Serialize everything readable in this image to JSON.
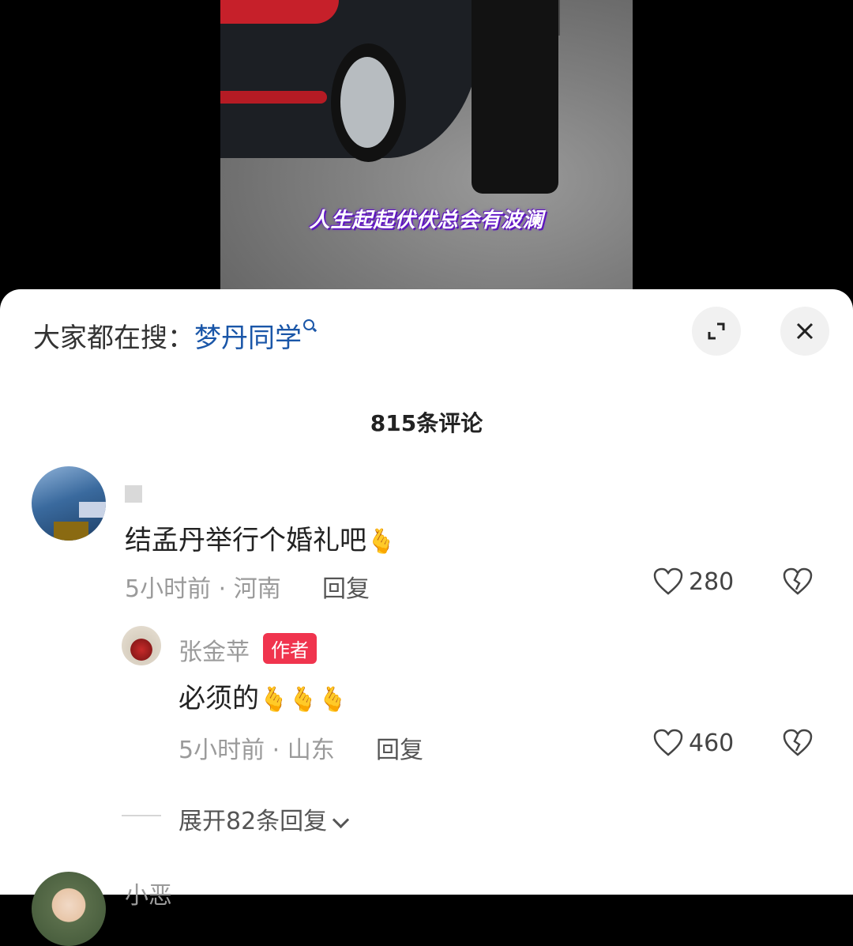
{
  "video": {
    "subtitle": "人生起起伏伏总会有波澜"
  },
  "sheet": {
    "search_prefix": "大家都在搜：",
    "search_keyword": "梦丹同学",
    "comment_count": "815条评论"
  },
  "comments": [
    {
      "text": "结孟丹举行个婚礼吧",
      "emoji": "🫰",
      "time": "5小时前 · 河南",
      "reply_label": "回复",
      "likes": "280"
    }
  ],
  "reply": {
    "author": "张金苹",
    "badge": "作者",
    "text": "必须的",
    "emojis": "🫰🫰🫰",
    "time": "5小时前 · 山东",
    "reply_label": "回复",
    "likes": "460"
  },
  "expand": {
    "label": "展开82条回复"
  },
  "next_comment": {
    "author": "小恶"
  },
  "colors": {
    "keyword": "#1a56a8",
    "badge": "#f0344e"
  }
}
